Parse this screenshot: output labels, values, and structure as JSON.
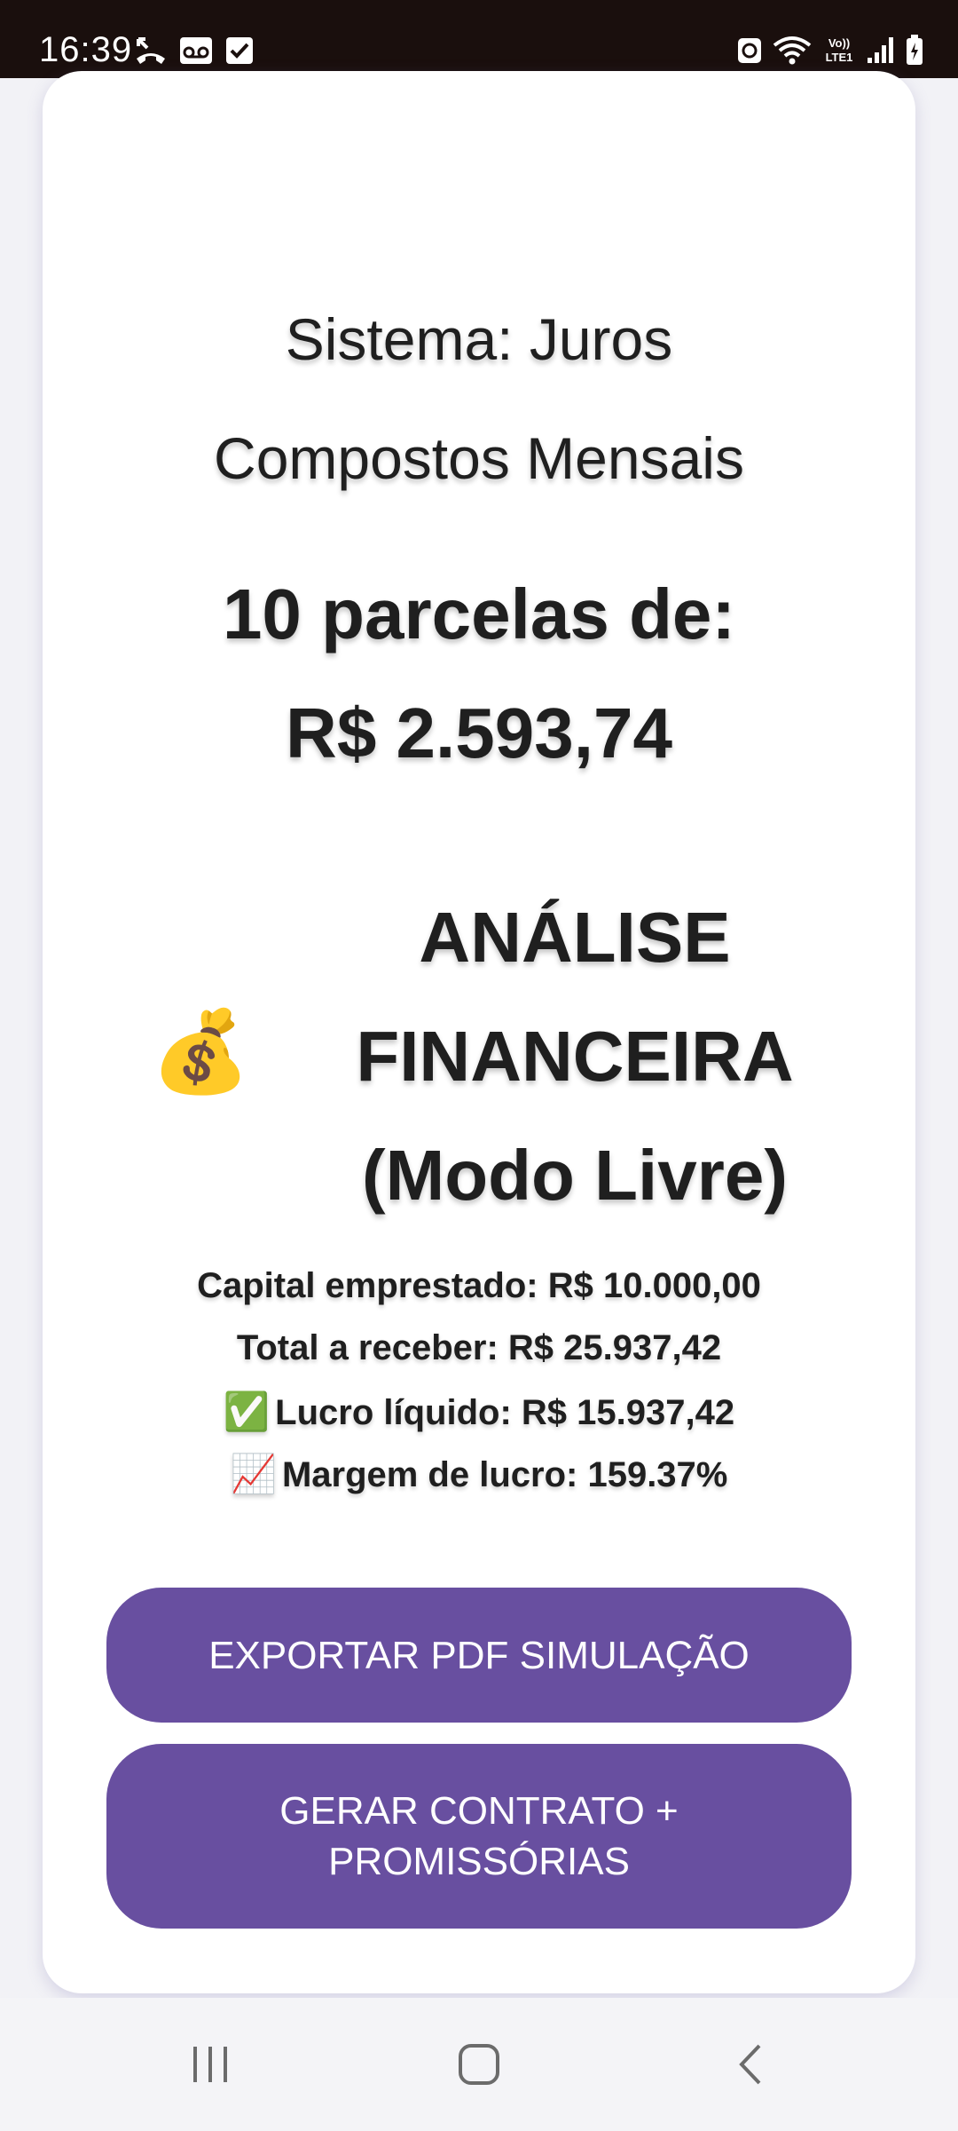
{
  "status_bar": {
    "time": "16:39"
  },
  "card": {
    "system_line1": "Sistema: Juros",
    "system_line2": "Compostos Mensais",
    "parcelas_line1": "10 parcelas de:",
    "parcelas_line2": "R$ 2.593,74",
    "analysis_emoji": "💰",
    "analysis_line1": "ANÁLISE",
    "analysis_line2": "FINANCEIRA",
    "analysis_line3": "(Modo Livre)",
    "capital": "Capital emprestado: R$ 10.000,00",
    "total": "Total a receber: R$ 25.937,42",
    "lucro_emoji": "✅",
    "lucro": "Lucro líquido: R$ 15.937,42",
    "margem_emoji": "📈",
    "margem": "Margem de lucro: 159.37%"
  },
  "buttons": {
    "export_pdf": "EXPORTAR PDF SIMULAÇÃO",
    "gerar_contrato": "GERAR CONTRATO + PROMISSÓRIAS"
  },
  "colors": {
    "button_bg": "#684fa0",
    "status_bar_bg": "#1a0f0d",
    "page_bg": "#f2f2f6"
  },
  "icons": {
    "status_left": [
      "missed-call-icon",
      "voicemail-icon",
      "checkbox-icon"
    ],
    "status_right": [
      "recycle-icon",
      "wifi-icon",
      "volte-icon",
      "signal-icon",
      "battery-icon"
    ],
    "nav": [
      "recents-icon",
      "home-icon",
      "back-icon"
    ]
  }
}
